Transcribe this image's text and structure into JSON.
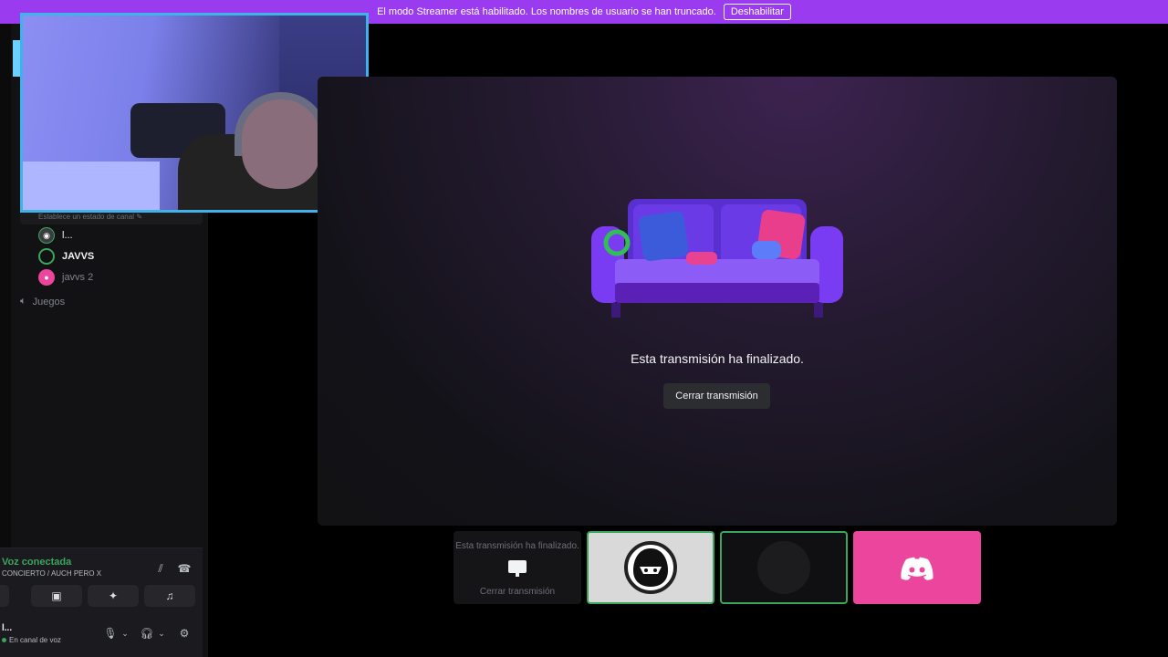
{
  "banner": {
    "text": "El modo Streamer está habilitado. Los nombres de usuario se han truncado.",
    "button_label": "Deshabilitar"
  },
  "sidebar": {
    "channel_status_placeholder": "Establece un estado de canal",
    "members": [
      {
        "name": "l..."
      },
      {
        "name": "JAVVS"
      },
      {
        "name": "javvs 2"
      }
    ],
    "voice_channel": "Juegos"
  },
  "voice_panel": {
    "title": "Voz conectada",
    "subtitle": "CONCIERTO / AUCH PERO X",
    "user_name": "l...",
    "user_status": "En canal de voz"
  },
  "stage": {
    "ended_text": "Esta transmisión ha finalizado.",
    "close_label": "Cerrar transmisión"
  },
  "tiles": {
    "stream_text": "Esta transmisión ha finalizado.",
    "stream_close": "Cerrar transmisión"
  },
  "colors": {
    "banner": "#9a3bf0",
    "accent_green": "#3ba55d",
    "discord_pink": "#eb459e",
    "webcam_border": "#3fb2e9"
  }
}
